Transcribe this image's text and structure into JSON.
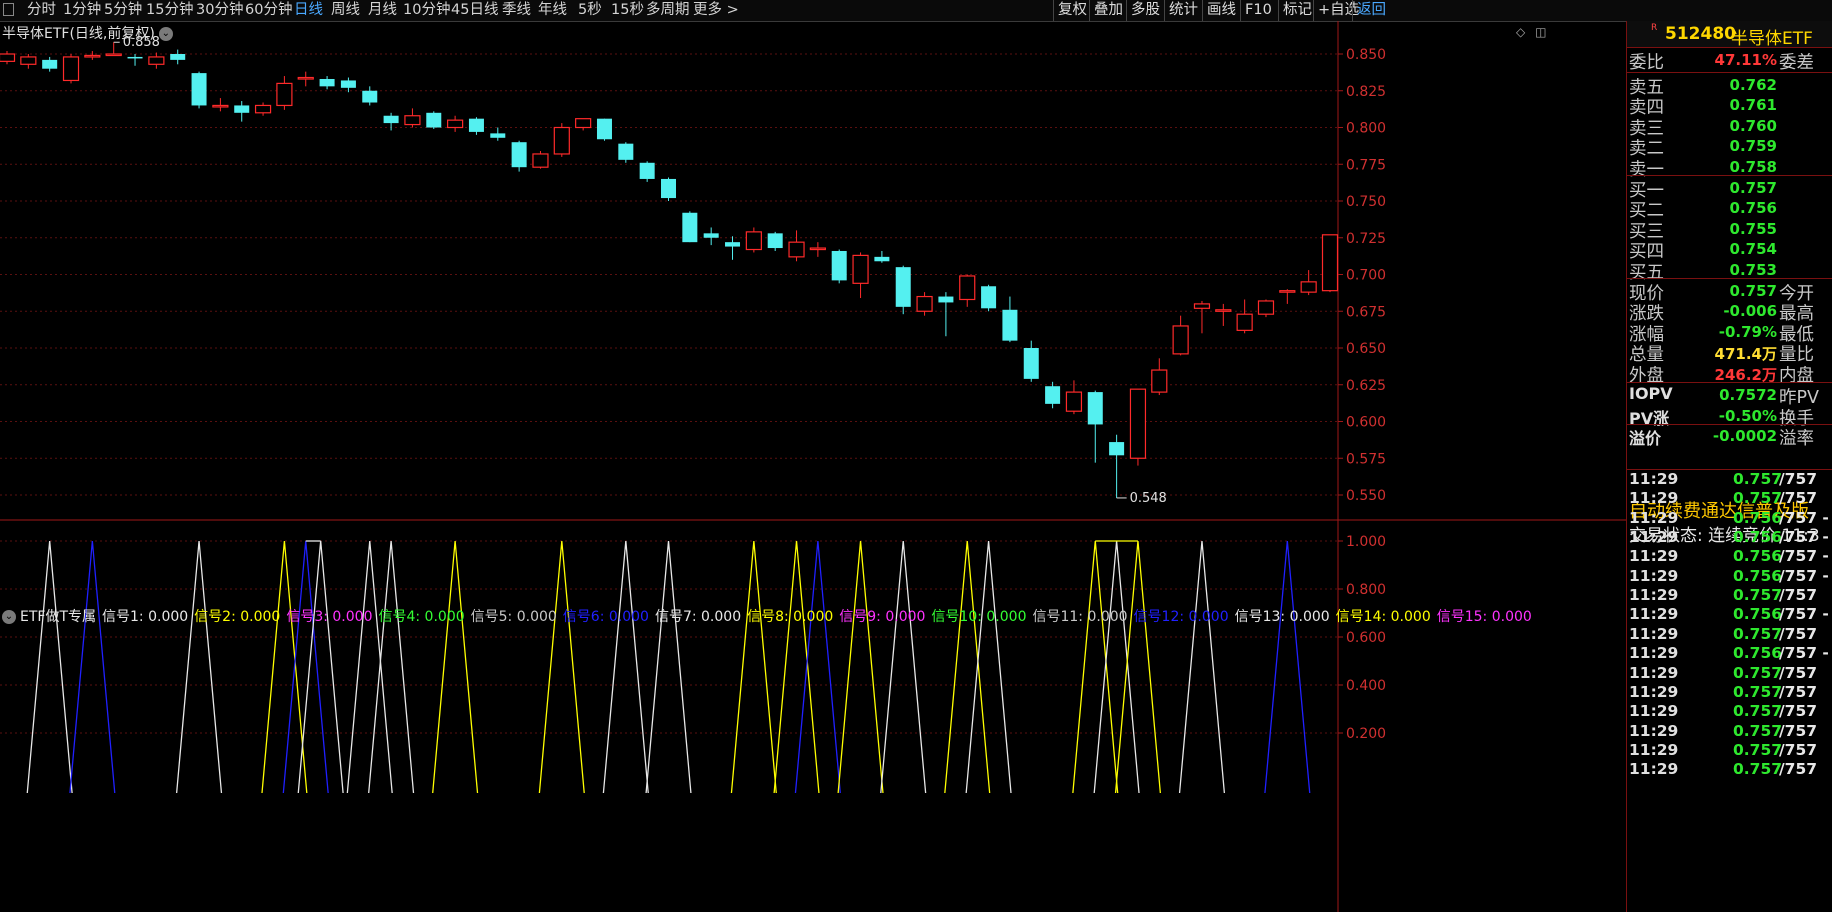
{
  "periods": [
    "分时",
    "1分钟",
    "5分钟",
    "15分钟",
    "30分钟",
    "60分钟",
    "日线",
    "周线",
    "月线",
    "10分钟",
    "45日线",
    "季线",
    "年线",
    "5秒",
    "15秒",
    "多周期",
    "更多 >"
  ],
  "active_period": "日线",
  "toolbar": [
    "复权",
    "叠加",
    "多股",
    "统计",
    "画线",
    "F10",
    "标记",
    "+自选",
    "返回"
  ],
  "chart": {
    "title": "半导体ETF(日线,前复权)",
    "high_label": "0.858",
    "low_label": "0.548",
    "price_axis": [
      "0.850",
      "0.825",
      "0.800",
      "0.775",
      "0.750",
      "0.725",
      "0.700",
      "0.675",
      "0.650",
      "0.625",
      "0.600",
      "0.575",
      "0.550"
    ],
    "indicator_axis": [
      "1.000",
      "0.800",
      "0.600",
      "0.400",
      "0.200"
    ]
  },
  "indicator": {
    "name": "ETF做T专属",
    "signals": [
      {
        "text": "信号1: 0.000",
        "color": "#e8e8e8"
      },
      {
        "text": "信号2: 0.000",
        "color": "#ffff00"
      },
      {
        "text": "信号3: 0.000",
        "color": "#ff33ff"
      },
      {
        "text": "信号4: 0.000",
        "color": "#33ff33"
      },
      {
        "text": "信号5: 0.000",
        "color": "#c8c8c8"
      },
      {
        "text": "信号6: 0.000",
        "color": "#2020ff"
      },
      {
        "text": "信号7: 0.000",
        "color": "#e8e8e8"
      },
      {
        "text": "信号8: 0.000",
        "color": "#ffff00"
      },
      {
        "text": "信号9: 0.000",
        "color": "#ff33ff"
      },
      {
        "text": "信号10: 0.000",
        "color": "#33ff33"
      },
      {
        "text": "信号11: 0.000",
        "color": "#c8c8c8"
      },
      {
        "text": "信号12: 0.000",
        "color": "#2020ff"
      },
      {
        "text": "信号13: 0.000",
        "color": "#e8e8e8"
      },
      {
        "text": "信号14: 0.000",
        "color": "#ffff00"
      },
      {
        "text": "信号15: 0.000",
        "color": "#ff33ff"
      }
    ]
  },
  "chart_data": {
    "type": "candlestick",
    "ylim": [
      0.545,
      0.865
    ],
    "candles": [
      {
        "o": 0.845,
        "c": 0.85,
        "h": 0.852,
        "l": 0.843
      },
      {
        "o": 0.843,
        "c": 0.848,
        "h": 0.85,
        "l": 0.84
      },
      {
        "o": 0.846,
        "c": 0.84,
        "h": 0.848,
        "l": 0.838
      },
      {
        "o": 0.832,
        "c": 0.848,
        "h": 0.85,
        "l": 0.83
      },
      {
        "o": 0.848,
        "c": 0.849,
        "h": 0.852,
        "l": 0.846
      },
      {
        "o": 0.85,
        "c": 0.85,
        "h": 0.858,
        "l": 0.849
      },
      {
        "o": 0.848,
        "c": 0.847,
        "h": 0.85,
        "l": 0.842
      },
      {
        "o": 0.843,
        "c": 0.848,
        "h": 0.851,
        "l": 0.84
      },
      {
        "o": 0.85,
        "c": 0.846,
        "h": 0.853,
        "l": 0.843
      },
      {
        "o": 0.837,
        "c": 0.815,
        "h": 0.838,
        "l": 0.813
      },
      {
        "o": 0.815,
        "c": 0.815,
        "h": 0.82,
        "l": 0.811
      },
      {
        "o": 0.815,
        "c": 0.81,
        "h": 0.818,
        "l": 0.804
      },
      {
        "o": 0.81,
        "c": 0.815,
        "h": 0.817,
        "l": 0.808
      },
      {
        "o": 0.815,
        "c": 0.83,
        "h": 0.835,
        "l": 0.812
      },
      {
        "o": 0.833,
        "c": 0.834,
        "h": 0.838,
        "l": 0.828
      },
      {
        "o": 0.833,
        "c": 0.828,
        "h": 0.835,
        "l": 0.826
      },
      {
        "o": 0.832,
        "c": 0.827,
        "h": 0.834,
        "l": 0.824
      },
      {
        "o": 0.825,
        "c": 0.817,
        "h": 0.828,
        "l": 0.815
      },
      {
        "o": 0.808,
        "c": 0.803,
        "h": 0.81,
        "l": 0.798
      },
      {
        "o": 0.802,
        "c": 0.808,
        "h": 0.813,
        "l": 0.8
      },
      {
        "o": 0.81,
        "c": 0.8,
        "h": 0.811,
        "l": 0.799
      },
      {
        "o": 0.8,
        "c": 0.805,
        "h": 0.808,
        "l": 0.797
      },
      {
        "o": 0.806,
        "c": 0.797,
        "h": 0.807,
        "l": 0.795
      },
      {
        "o": 0.796,
        "c": 0.793,
        "h": 0.8,
        "l": 0.791
      },
      {
        "o": 0.79,
        "c": 0.773,
        "h": 0.791,
        "l": 0.77
      },
      {
        "o": 0.773,
        "c": 0.782,
        "h": 0.784,
        "l": 0.772
      },
      {
        "o": 0.782,
        "c": 0.8,
        "h": 0.803,
        "l": 0.78
      },
      {
        "o": 0.8,
        "c": 0.806,
        "h": 0.806,
        "l": 0.798
      },
      {
        "o": 0.806,
        "c": 0.792,
        "h": 0.806,
        "l": 0.791
      },
      {
        "o": 0.789,
        "c": 0.778,
        "h": 0.79,
        "l": 0.776
      },
      {
        "o": 0.776,
        "c": 0.765,
        "h": 0.777,
        "l": 0.763
      },
      {
        "o": 0.765,
        "c": 0.752,
        "h": 0.766,
        "l": 0.75
      },
      {
        "o": 0.742,
        "c": 0.722,
        "h": 0.743,
        "l": 0.722
      },
      {
        "o": 0.728,
        "c": 0.725,
        "h": 0.732,
        "l": 0.72
      },
      {
        "o": 0.722,
        "c": 0.719,
        "h": 0.726,
        "l": 0.71
      },
      {
        "o": 0.717,
        "c": 0.729,
        "h": 0.732,
        "l": 0.715
      },
      {
        "o": 0.728,
        "c": 0.718,
        "h": 0.729,
        "l": 0.716
      },
      {
        "o": 0.712,
        "c": 0.722,
        "h": 0.73,
        "l": 0.709
      },
      {
        "o": 0.718,
        "c": 0.718,
        "h": 0.722,
        "l": 0.712
      },
      {
        "o": 0.716,
        "c": 0.696,
        "h": 0.717,
        "l": 0.694
      },
      {
        "o": 0.694,
        "c": 0.713,
        "h": 0.715,
        "l": 0.684
      },
      {
        "o": 0.712,
        "c": 0.709,
        "h": 0.716,
        "l": 0.708
      },
      {
        "o": 0.705,
        "c": 0.678,
        "h": 0.706,
        "l": 0.673
      },
      {
        "o": 0.675,
        "c": 0.685,
        "h": 0.688,
        "l": 0.672
      },
      {
        "o": 0.685,
        "c": 0.681,
        "h": 0.688,
        "l": 0.658
      },
      {
        "o": 0.683,
        "c": 0.699,
        "h": 0.7,
        "l": 0.678
      },
      {
        "o": 0.692,
        "c": 0.677,
        "h": 0.693,
        "l": 0.675
      },
      {
        "o": 0.676,
        "c": 0.655,
        "h": 0.685,
        "l": 0.654
      },
      {
        "o": 0.65,
        "c": 0.629,
        "h": 0.655,
        "l": 0.627
      },
      {
        "o": 0.624,
        "c": 0.612,
        "h": 0.627,
        "l": 0.609
      },
      {
        "o": 0.607,
        "c": 0.62,
        "h": 0.628,
        "l": 0.605
      },
      {
        "o": 0.62,
        "c": 0.598,
        "h": 0.621,
        "l": 0.572
      },
      {
        "o": 0.586,
        "c": 0.577,
        "h": 0.591,
        "l": 0.548
      },
      {
        "o": 0.575,
        "c": 0.622,
        "h": 0.622,
        "l": 0.57
      },
      {
        "o": 0.62,
        "c": 0.635,
        "h": 0.643,
        "l": 0.618
      },
      {
        "o": 0.646,
        "c": 0.665,
        "h": 0.672,
        "l": 0.645
      },
      {
        "o": 0.677,
        "c": 0.68,
        "h": 0.682,
        "l": 0.66
      },
      {
        "o": 0.675,
        "c": 0.676,
        "h": 0.68,
        "l": 0.665
      },
      {
        "o": 0.662,
        "c": 0.673,
        "h": 0.683,
        "l": 0.66
      },
      {
        "o": 0.673,
        "c": 0.682,
        "h": 0.683,
        "l": 0.671
      },
      {
        "o": 0.688,
        "c": 0.689,
        "h": 0.69,
        "l": 0.68
      },
      {
        "o": 0.688,
        "c": 0.695,
        "h": 0.703,
        "l": 0.686
      },
      {
        "o": 0.689,
        "c": 0.727,
        "h": 0.727,
        "l": 0.688
      }
    ],
    "indicator_ylim": [
      0.0,
      1.08
    ],
    "signal_peaks": [
      {
        "x": 2,
        "color": "#e8e8e8"
      },
      {
        "x": 4,
        "color": "#2020ff"
      },
      {
        "x": 9,
        "color": "#e8e8e8"
      },
      {
        "x": 13,
        "color": "#ffff00"
      },
      {
        "x": 14,
        "color": "#2020ff"
      },
      {
        "x": 14.7,
        "color": "#e8e8e8"
      },
      {
        "x": 17,
        "color": "#e8e8e8"
      },
      {
        "x": 18,
        "color": "#e8e8e8"
      },
      {
        "x": 21,
        "color": "#ffff00"
      },
      {
        "x": 26,
        "color": "#ffff00"
      },
      {
        "x": 29,
        "color": "#e8e8e8"
      },
      {
        "x": 31,
        "color": "#e8e8e8"
      },
      {
        "x": 35,
        "color": "#ffff00"
      },
      {
        "x": 37,
        "color": "#ffff00"
      },
      {
        "x": 38,
        "color": "#2020ff"
      },
      {
        "x": 40,
        "color": "#ffff00"
      },
      {
        "x": 42,
        "color": "#e8e8e8"
      },
      {
        "x": 45,
        "color": "#ffff00"
      },
      {
        "x": 46,
        "color": "#e8e8e8"
      },
      {
        "x": 51,
        "color": "#ffff00"
      },
      {
        "x": 52,
        "color": "#e8e8e8"
      },
      {
        "x": 53,
        "color": "#ffff00"
      },
      {
        "x": 56,
        "color": "#e8e8e8"
      },
      {
        "x": 60,
        "color": "#2020ff"
      }
    ]
  },
  "quote": {
    "r_mark": "R",
    "code": "512480",
    "name": "半导体ETF",
    "weibi_label": "委比",
    "weibi_value": "47.11%",
    "weicha_label": "委差",
    "sells": [
      {
        "label": "卖五",
        "price": "0.762"
      },
      {
        "label": "卖四",
        "price": "0.761"
      },
      {
        "label": "卖三",
        "price": "0.760"
      },
      {
        "label": "卖二",
        "price": "0.759"
      },
      {
        "label": "卖一",
        "price": "0.758"
      }
    ],
    "buys": [
      {
        "label": "买一",
        "price": "0.757"
      },
      {
        "label": "买二",
        "price": "0.756"
      },
      {
        "label": "买三",
        "price": "0.755"
      },
      {
        "label": "买四",
        "price": "0.754"
      },
      {
        "label": "买五",
        "price": "0.753"
      }
    ],
    "stats": [
      {
        "label": "现价",
        "value": "0.757",
        "color": "g",
        "label2": "今开"
      },
      {
        "label": "涨跌",
        "value": "-0.006",
        "color": "g",
        "label2": "最高"
      },
      {
        "label": "涨幅",
        "value": "-0.79%",
        "color": "g",
        "label2": "最低"
      },
      {
        "label": "总量",
        "value": "471.4万",
        "color": "y",
        "label2": "量比"
      },
      {
        "label": "外盘",
        "value": "246.2万",
        "color": "r",
        "label2": "内盘"
      }
    ],
    "pv": [
      {
        "label": "IOPV",
        "value": "0.7572",
        "color": "g",
        "label2": "昨PV"
      },
      {
        "label": "PV涨",
        "value": "-0.50%",
        "color": "g",
        "label2": "换手"
      },
      {
        "label": "溢价",
        "value": "-0.0002",
        "color": "g",
        "label2": "溢率"
      }
    ],
    "notice": "自动续费通达信普及版",
    "state": "交易状态: 连续竞价 11:3",
    "ticks": [
      {
        "time": "11:29",
        "price": "0.757",
        "vol": "/757"
      },
      {
        "time": "11:29",
        "price": "0.757",
        "vol": "/757"
      },
      {
        "time": "11:29",
        "price": "0.756",
        "vol": "/757 -"
      },
      {
        "time": "11:29",
        "price": "0.756",
        "vol": "/757 -"
      },
      {
        "time": "11:29",
        "price": "0.756",
        "vol": "/757 -"
      },
      {
        "time": "11:29",
        "price": "0.756",
        "vol": "/757 -"
      },
      {
        "time": "11:29",
        "price": "0.757",
        "vol": "/757"
      },
      {
        "time": "11:29",
        "price": "0.756",
        "vol": "/757 -"
      },
      {
        "time": "11:29",
        "price": "0.757",
        "vol": "/757"
      },
      {
        "time": "11:29",
        "price": "0.756",
        "vol": "/757 -"
      },
      {
        "time": "11:29",
        "price": "0.757",
        "vol": "/757"
      },
      {
        "time": "11:29",
        "price": "0.757",
        "vol": "/757"
      },
      {
        "time": "11:29",
        "price": "0.757",
        "vol": "/757"
      },
      {
        "time": "11:29",
        "price": "0.757",
        "vol": "/757"
      },
      {
        "time": "11:29",
        "price": "0.757",
        "vol": "/757"
      },
      {
        "time": "11:29",
        "price": "0.757",
        "vol": "/757"
      }
    ]
  }
}
